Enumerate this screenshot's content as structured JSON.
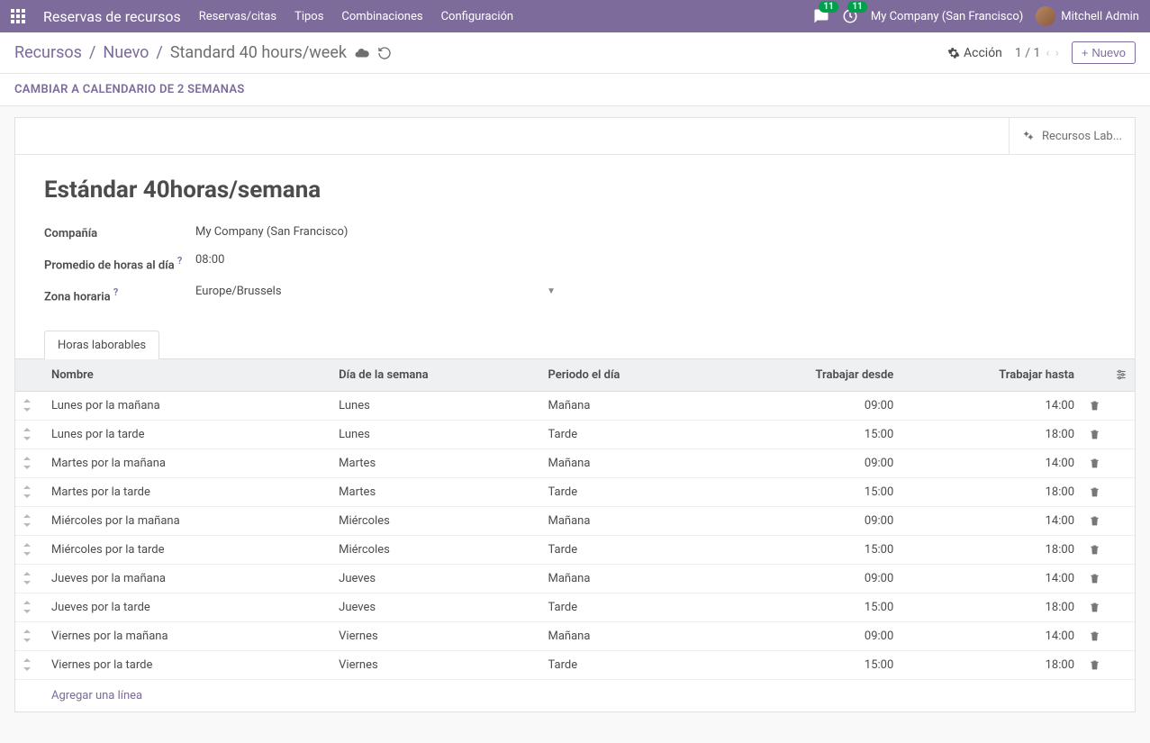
{
  "navbar": {
    "app_title": "Reservas de recursos",
    "menu": [
      "Reservas/citas",
      "Tipos",
      "Combinaciones",
      "Configuración"
    ],
    "msg_badge": "11",
    "activity_badge": "11",
    "company": "My Company (San Francisco)",
    "user": "Mitchell Admin"
  },
  "breadcrumb": {
    "root": "Recursos",
    "new": "Nuevo",
    "current": "Standard 40 hours/week"
  },
  "controls": {
    "action_label": "Acción",
    "pager": "1 / 1",
    "new_label": "Nuevo"
  },
  "status": {
    "switch_label": "CAMBIAR A CALENDARIO DE 2 SEMANAS"
  },
  "stat_button": {
    "label": "Recursos Lab..."
  },
  "form": {
    "title": "Estándar 40horas/semana",
    "company_label": "Compañía",
    "company_value": "My Company (San Francisco)",
    "avg_label": "Promedio de horas al día",
    "avg_value": "08:00",
    "tz_label": "Zona horaria",
    "tz_value": "Europe/Brussels"
  },
  "tab": {
    "label": "Horas laborables"
  },
  "table": {
    "headers": {
      "name": "Nombre",
      "day": "Día de la semana",
      "period": "Periodo el día",
      "from": "Trabajar desde",
      "to": "Trabajar hasta"
    },
    "rows": [
      {
        "name": "Lunes por la mañana",
        "day": "Lunes",
        "period": "Mañana",
        "from": "09:00",
        "to": "14:00"
      },
      {
        "name": "Lunes por la tarde",
        "day": "Lunes",
        "period": "Tarde",
        "from": "15:00",
        "to": "18:00"
      },
      {
        "name": "Martes por la mañana",
        "day": "Martes",
        "period": "Mañana",
        "from": "09:00",
        "to": "14:00"
      },
      {
        "name": "Martes por la tarde",
        "day": "Martes",
        "period": "Tarde",
        "from": "15:00",
        "to": "18:00"
      },
      {
        "name": "Miércoles por la mañana",
        "day": "Miércoles",
        "period": "Mañana",
        "from": "09:00",
        "to": "14:00"
      },
      {
        "name": "Miércoles por la tarde",
        "day": "Miércoles",
        "period": "Tarde",
        "from": "15:00",
        "to": "18:00"
      },
      {
        "name": "Jueves por la mañana",
        "day": "Jueves",
        "period": "Mañana",
        "from": "09:00",
        "to": "14:00"
      },
      {
        "name": "Jueves por la tarde",
        "day": "Jueves",
        "period": "Tarde",
        "from": "15:00",
        "to": "18:00"
      },
      {
        "name": "Viernes por la mañana",
        "day": "Viernes",
        "period": "Mañana",
        "from": "09:00",
        "to": "14:00"
      },
      {
        "name": "Viernes por la tarde",
        "day": "Viernes",
        "period": "Tarde",
        "from": "15:00",
        "to": "18:00"
      }
    ],
    "add_line": "Agregar una línea"
  }
}
